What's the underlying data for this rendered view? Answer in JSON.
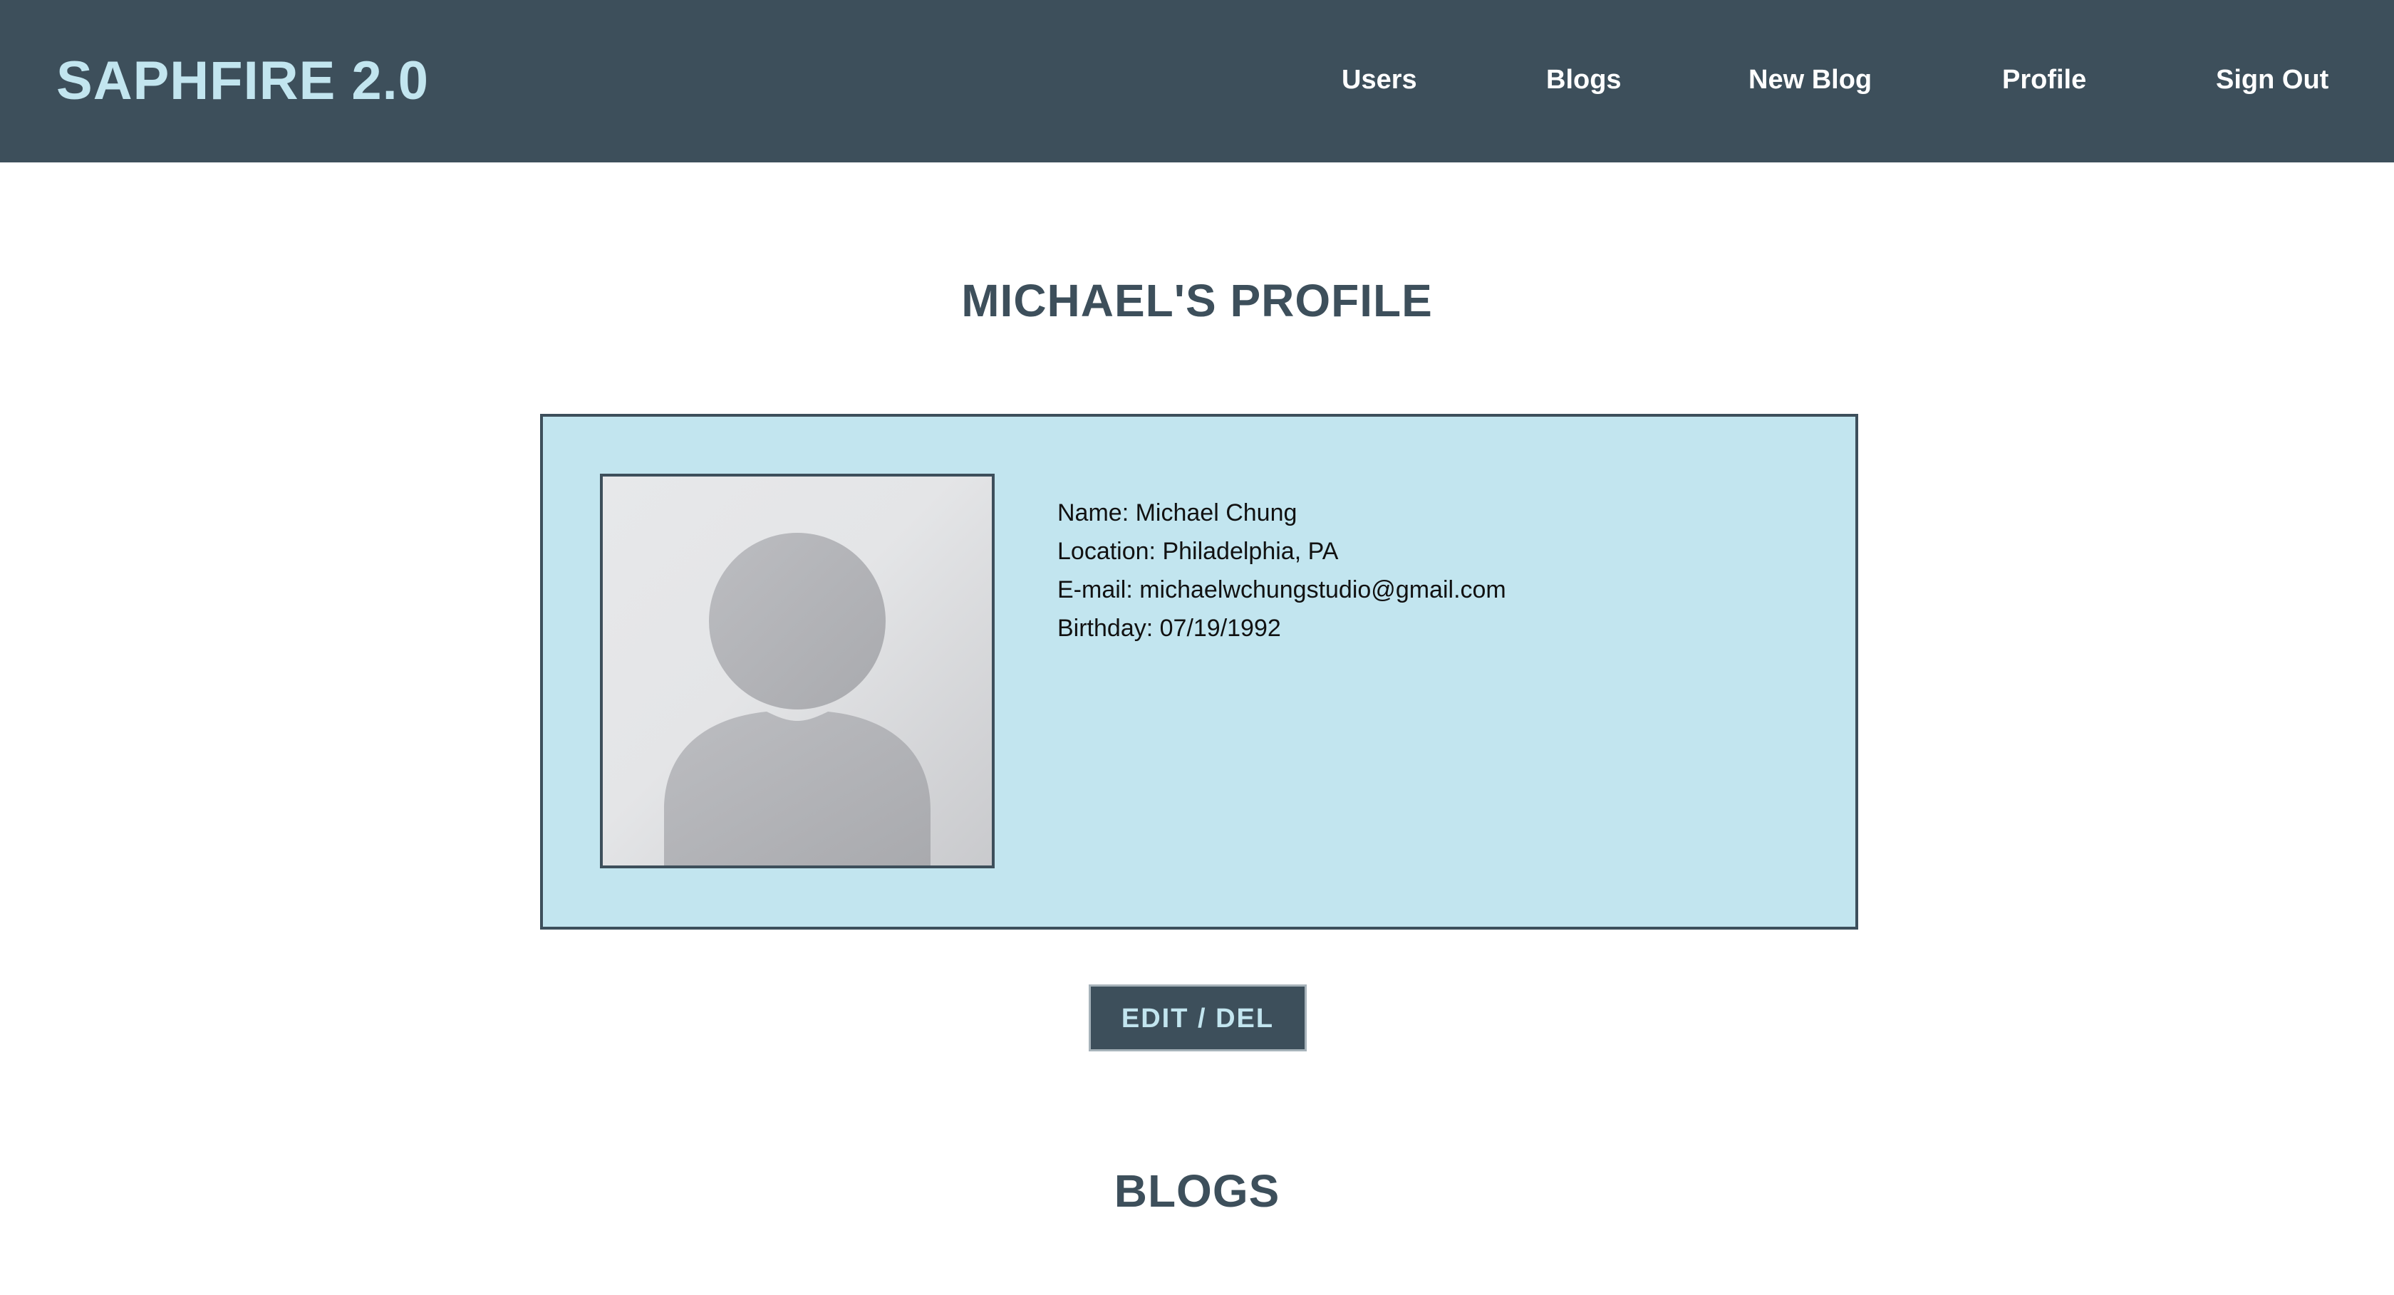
{
  "header": {
    "brand": "SAPHFIRE 2.0",
    "nav": [
      {
        "label": "Users"
      },
      {
        "label": "Blogs"
      },
      {
        "label": "New Blog"
      },
      {
        "label": "Profile"
      },
      {
        "label": "Sign Out"
      }
    ]
  },
  "profile": {
    "title": "MICHAEL'S PROFILE",
    "avatar_icon": "user-placeholder-icon",
    "fields": [
      {
        "text": "Name: Michael Chung"
      },
      {
        "text": "Location: Philadelphia, PA"
      },
      {
        "text": "E-mail: michaelwchungstudio@gmail.com"
      },
      {
        "text": "Birthday: 07/19/1992"
      }
    ],
    "edit_button_label": "EDIT / DEL"
  },
  "blogs": {
    "title": "BLOGS"
  },
  "colors": {
    "navbar": "#3d4f5b",
    "accent": "#c2e5ef",
    "text_dark": "#3d4f5b"
  }
}
